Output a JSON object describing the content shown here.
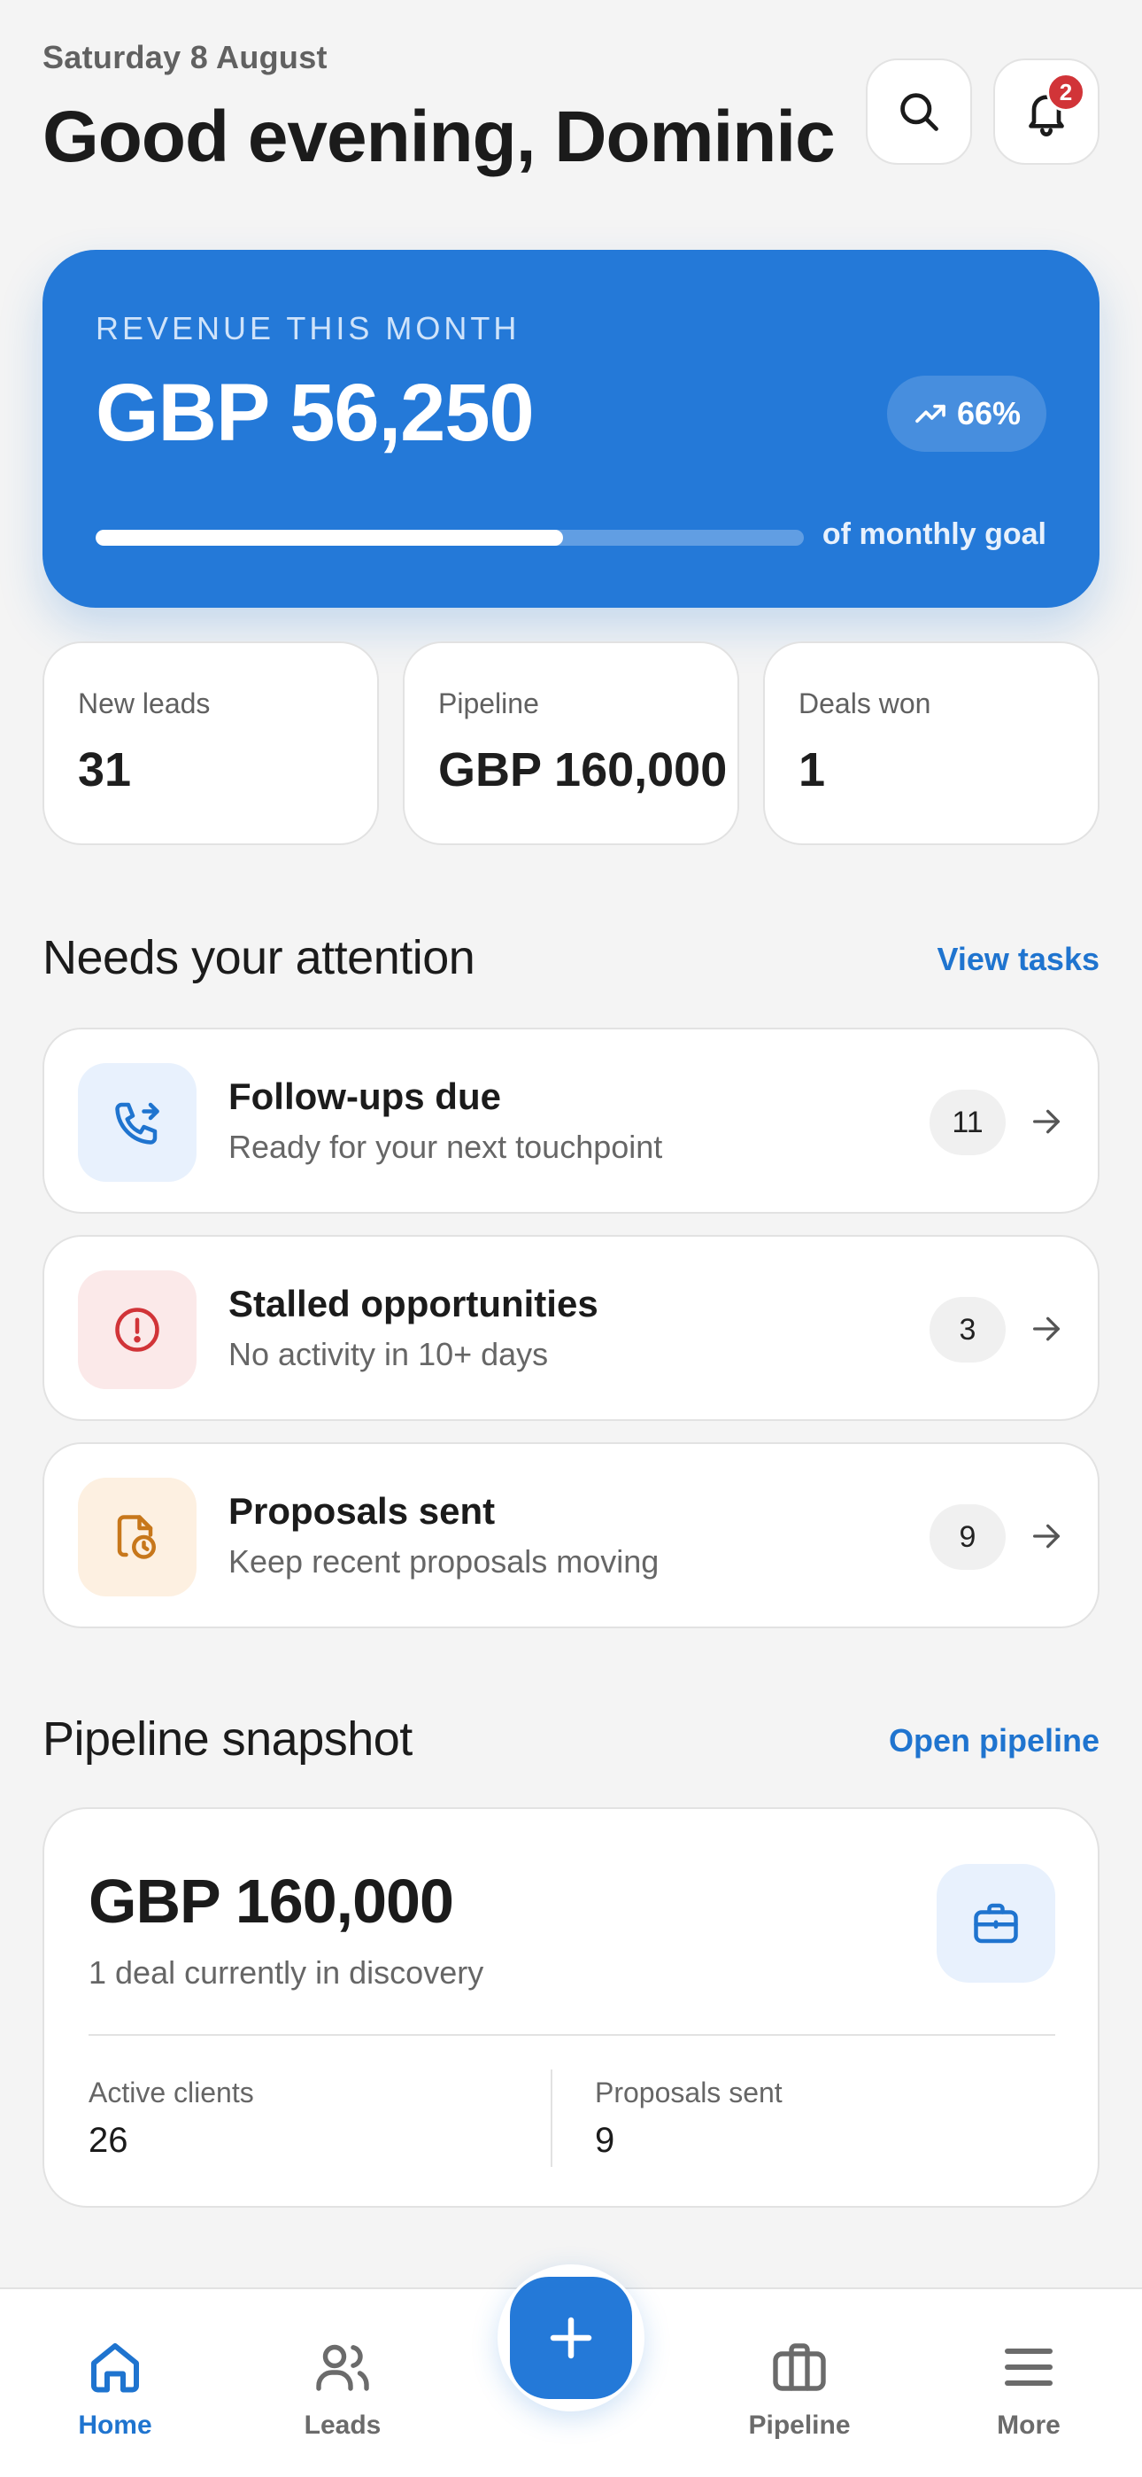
{
  "header": {
    "date": "Saturday 8 August",
    "greeting": "Good evening, Dominic",
    "notification_count": "2"
  },
  "revenue": {
    "label": "REVENUE THIS MONTH",
    "value": "GBP 56,250",
    "percent": "66%",
    "progress_fraction": 0.66,
    "goal_text": "of monthly goal"
  },
  "stats": [
    {
      "label": "New leads",
      "value": "31"
    },
    {
      "label": "Pipeline",
      "value": "GBP 160,000"
    },
    {
      "label": "Deals won",
      "value": "1"
    }
  ],
  "attention": {
    "title": "Needs your attention",
    "link": "View tasks",
    "items": [
      {
        "title": "Follow-ups due",
        "subtitle": "Ready for your next touchpoint",
        "count": "11",
        "icon": "phone-forward-icon",
        "color": "#1f74cf",
        "bg": "#e8f1fd"
      },
      {
        "title": "Stalled opportunities",
        "subtitle": "No activity in 10+ days",
        "count": "3",
        "icon": "alert-circle-icon",
        "color": "#d13438",
        "bg": "#fbe9e9"
      },
      {
        "title": "Proposals sent",
        "subtitle": "Keep recent proposals moving",
        "count": "9",
        "icon": "document-clock-icon",
        "color": "#c7771b",
        "bg": "#fdf0e1"
      }
    ]
  },
  "pipeline": {
    "title": "Pipeline snapshot",
    "link": "Open pipeline",
    "value": "GBP 160,000",
    "subtitle": "1 deal currently in discovery",
    "active_clients_label": "Active clients",
    "active_clients_value": "26",
    "proposals_label": "Proposals sent",
    "proposals_value": "9"
  },
  "nav": {
    "home": "Home",
    "leads": "Leads",
    "pipeline": "Pipeline",
    "more": "More"
  },
  "colors": {
    "accent": "#2479d8",
    "link": "#1f74cf",
    "danger": "#d13438",
    "warning": "#c7771b"
  }
}
